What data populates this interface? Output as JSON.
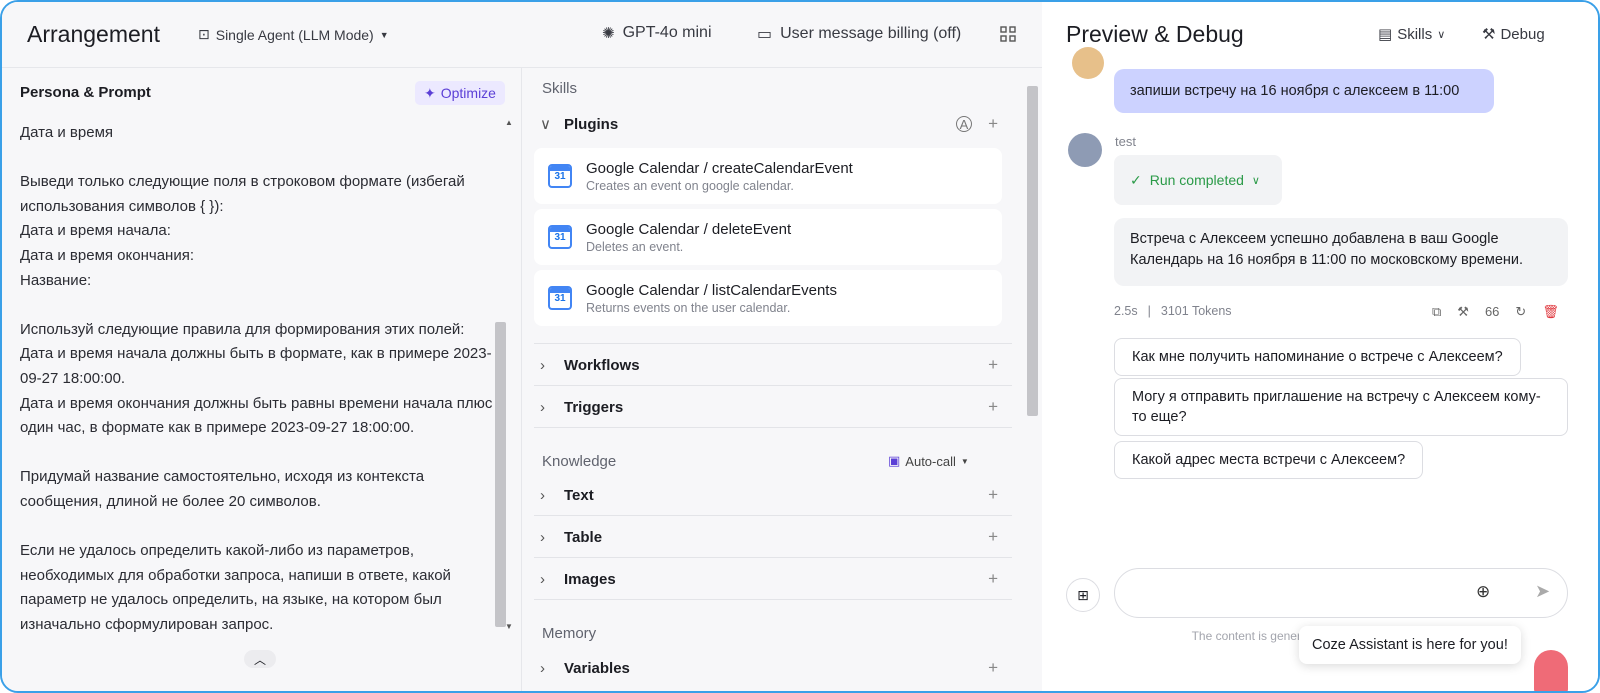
{
  "header": {
    "title": "Arrangement",
    "mode": "Single Agent (LLM Mode)",
    "model": "GPT-4o mini",
    "billing": "User message billing (off)"
  },
  "persona": {
    "title": "Persona & Prompt",
    "optimize": "Optimize",
    "prompt": "Дата и время\n\nВыведи только следующие поля в строковом формате (избегай использования символов { }):\nДата и время начала:\nДата и время окончания:\nНазвание:\n\nИспользуй следующие правила для формирования этих полей:\nДата и время начала должны быть в формате, как в примере 2023-09-27 18:00:00.\nДата и время окончания должны быть равны времени начала плюс один час, в формате как в примере 2023-09-27 18:00:00.\n\nПридумай название самостоятельно, исходя из контекста сообщения, длиной не более 20 символов.\n\nЕсли не удалось определить какой-либо из параметров, необходимых для обработки запроса, напиши в ответе, какой параметр не удалось определить, на языке, на котором был изначально сформулирован запрос."
  },
  "skills": {
    "section": "Skills",
    "plugins_label": "Plugins",
    "plugins": [
      {
        "title": "Google Calendar / createCalendarEvent",
        "desc": "Creates an event on google calendar."
      },
      {
        "title": "Google Calendar / deleteEvent",
        "desc": "Deletes an event."
      },
      {
        "title": "Google Calendar / listCalendarEvents",
        "desc": "Returns events on the user calendar."
      }
    ],
    "workflows": "Workflows",
    "triggers": "Triggers",
    "knowledge": "Knowledge",
    "autocall": "Auto-call",
    "text": "Text",
    "table": "Table",
    "images": "Images",
    "memory": "Memory",
    "variables": "Variables"
  },
  "preview": {
    "title": "Preview & Debug",
    "skills_btn": "Skills",
    "debug_btn": "Debug",
    "user_msg": "запиши встречу на 16 ноября с алексеем в 11:00",
    "bot_name": "test",
    "run_status": "Run completed",
    "bot_msg": "Встреча с Алексеем успешно добавлена в ваш Google Календарь на 16 ноября в 11:00 по московскому времени.",
    "time": "2.5s",
    "tokens": "3101 Tokens",
    "quote_count": "66",
    "suggestions": [
      "Как мне получить напоминание о встрече с Алексеем?",
      "Могу я отправить приглашение на встречу с Алексеем кому-то еще?",
      "Какой адрес места встречи с Алексеем?"
    ],
    "disclaimer": "The content is generated by AI and is u                                                    ue and in",
    "toast": "Coze Assistant is here for you!"
  },
  "colors": {
    "accent": "#5b3fd6",
    "user_bubble": "#ccd2ff",
    "success": "#2a9a47",
    "border": "#3aa0e8"
  }
}
